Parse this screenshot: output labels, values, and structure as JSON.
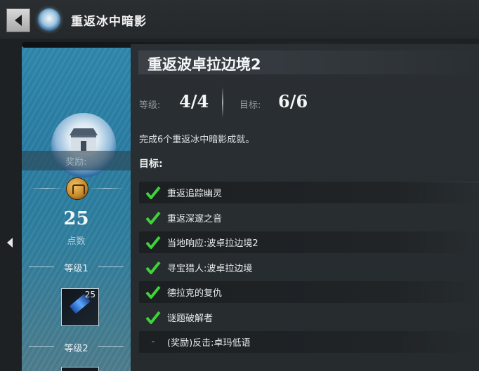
{
  "header": {
    "title": "重返冰中暗影"
  },
  "sidebar": {
    "reward_label": "奖励:",
    "points": "25",
    "points_label": "点数",
    "tiers": [
      {
        "label": "等级1",
        "item_count": "25"
      },
      {
        "label": "等级2"
      }
    ]
  },
  "achievement": {
    "title": "重返波卓拉边境2",
    "tier_label": "等级:",
    "tier_value": "4/4",
    "goal_label": "目标:",
    "goal_value": "6/6",
    "description": "完成6个重返冰中暗影成就。",
    "objectives_heading": "目标:",
    "objectives": [
      {
        "text": "重返追踪幽灵",
        "done": true
      },
      {
        "text": "重返深邃之音",
        "done": true
      },
      {
        "text": "当地响应:波卓拉边境2",
        "done": true
      },
      {
        "text": "寻宝猎人:波卓拉边境",
        "done": true
      },
      {
        "text": "德拉克的复仇",
        "done": true
      },
      {
        "text": "谜题破解者",
        "done": true
      },
      {
        "text": "(奖励)反击:卓玛低语",
        "done": false,
        "marker": "-"
      }
    ]
  },
  "colors": {
    "check_green": "#3fd23a",
    "panel_blue": "#2a7ea3"
  }
}
